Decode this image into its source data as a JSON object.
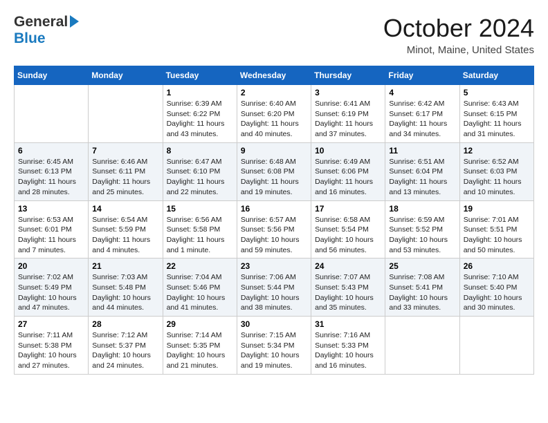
{
  "logo": {
    "line1": "General",
    "line2": "Blue",
    "arrow": "▶"
  },
  "title": "October 2024",
  "location": "Minot, Maine, United States",
  "days_of_week": [
    "Sunday",
    "Monday",
    "Tuesday",
    "Wednesday",
    "Thursday",
    "Friday",
    "Saturday"
  ],
  "weeks": [
    [
      {
        "day": "",
        "info": ""
      },
      {
        "day": "",
        "info": ""
      },
      {
        "day": "1",
        "info": "Sunrise: 6:39 AM\nSunset: 6:22 PM\nDaylight: 11 hours and 43 minutes."
      },
      {
        "day": "2",
        "info": "Sunrise: 6:40 AM\nSunset: 6:20 PM\nDaylight: 11 hours and 40 minutes."
      },
      {
        "day": "3",
        "info": "Sunrise: 6:41 AM\nSunset: 6:19 PM\nDaylight: 11 hours and 37 minutes."
      },
      {
        "day": "4",
        "info": "Sunrise: 6:42 AM\nSunset: 6:17 PM\nDaylight: 11 hours and 34 minutes."
      },
      {
        "day": "5",
        "info": "Sunrise: 6:43 AM\nSunset: 6:15 PM\nDaylight: 11 hours and 31 minutes."
      }
    ],
    [
      {
        "day": "6",
        "info": "Sunrise: 6:45 AM\nSunset: 6:13 PM\nDaylight: 11 hours and 28 minutes."
      },
      {
        "day": "7",
        "info": "Sunrise: 6:46 AM\nSunset: 6:11 PM\nDaylight: 11 hours and 25 minutes."
      },
      {
        "day": "8",
        "info": "Sunrise: 6:47 AM\nSunset: 6:10 PM\nDaylight: 11 hours and 22 minutes."
      },
      {
        "day": "9",
        "info": "Sunrise: 6:48 AM\nSunset: 6:08 PM\nDaylight: 11 hours and 19 minutes."
      },
      {
        "day": "10",
        "info": "Sunrise: 6:49 AM\nSunset: 6:06 PM\nDaylight: 11 hours and 16 minutes."
      },
      {
        "day": "11",
        "info": "Sunrise: 6:51 AM\nSunset: 6:04 PM\nDaylight: 11 hours and 13 minutes."
      },
      {
        "day": "12",
        "info": "Sunrise: 6:52 AM\nSunset: 6:03 PM\nDaylight: 11 hours and 10 minutes."
      }
    ],
    [
      {
        "day": "13",
        "info": "Sunrise: 6:53 AM\nSunset: 6:01 PM\nDaylight: 11 hours and 7 minutes."
      },
      {
        "day": "14",
        "info": "Sunrise: 6:54 AM\nSunset: 5:59 PM\nDaylight: 11 hours and 4 minutes."
      },
      {
        "day": "15",
        "info": "Sunrise: 6:56 AM\nSunset: 5:58 PM\nDaylight: 11 hours and 1 minute."
      },
      {
        "day": "16",
        "info": "Sunrise: 6:57 AM\nSunset: 5:56 PM\nDaylight: 10 hours and 59 minutes."
      },
      {
        "day": "17",
        "info": "Sunrise: 6:58 AM\nSunset: 5:54 PM\nDaylight: 10 hours and 56 minutes."
      },
      {
        "day": "18",
        "info": "Sunrise: 6:59 AM\nSunset: 5:52 PM\nDaylight: 10 hours and 53 minutes."
      },
      {
        "day": "19",
        "info": "Sunrise: 7:01 AM\nSunset: 5:51 PM\nDaylight: 10 hours and 50 minutes."
      }
    ],
    [
      {
        "day": "20",
        "info": "Sunrise: 7:02 AM\nSunset: 5:49 PM\nDaylight: 10 hours and 47 minutes."
      },
      {
        "day": "21",
        "info": "Sunrise: 7:03 AM\nSunset: 5:48 PM\nDaylight: 10 hours and 44 minutes."
      },
      {
        "day": "22",
        "info": "Sunrise: 7:04 AM\nSunset: 5:46 PM\nDaylight: 10 hours and 41 minutes."
      },
      {
        "day": "23",
        "info": "Sunrise: 7:06 AM\nSunset: 5:44 PM\nDaylight: 10 hours and 38 minutes."
      },
      {
        "day": "24",
        "info": "Sunrise: 7:07 AM\nSunset: 5:43 PM\nDaylight: 10 hours and 35 minutes."
      },
      {
        "day": "25",
        "info": "Sunrise: 7:08 AM\nSunset: 5:41 PM\nDaylight: 10 hours and 33 minutes."
      },
      {
        "day": "26",
        "info": "Sunrise: 7:10 AM\nSunset: 5:40 PM\nDaylight: 10 hours and 30 minutes."
      }
    ],
    [
      {
        "day": "27",
        "info": "Sunrise: 7:11 AM\nSunset: 5:38 PM\nDaylight: 10 hours and 27 minutes."
      },
      {
        "day": "28",
        "info": "Sunrise: 7:12 AM\nSunset: 5:37 PM\nDaylight: 10 hours and 24 minutes."
      },
      {
        "day": "29",
        "info": "Sunrise: 7:14 AM\nSunset: 5:35 PM\nDaylight: 10 hours and 21 minutes."
      },
      {
        "day": "30",
        "info": "Sunrise: 7:15 AM\nSunset: 5:34 PM\nDaylight: 10 hours and 19 minutes."
      },
      {
        "day": "31",
        "info": "Sunrise: 7:16 AM\nSunset: 5:33 PM\nDaylight: 10 hours and 16 minutes."
      },
      {
        "day": "",
        "info": ""
      },
      {
        "day": "",
        "info": ""
      }
    ]
  ]
}
